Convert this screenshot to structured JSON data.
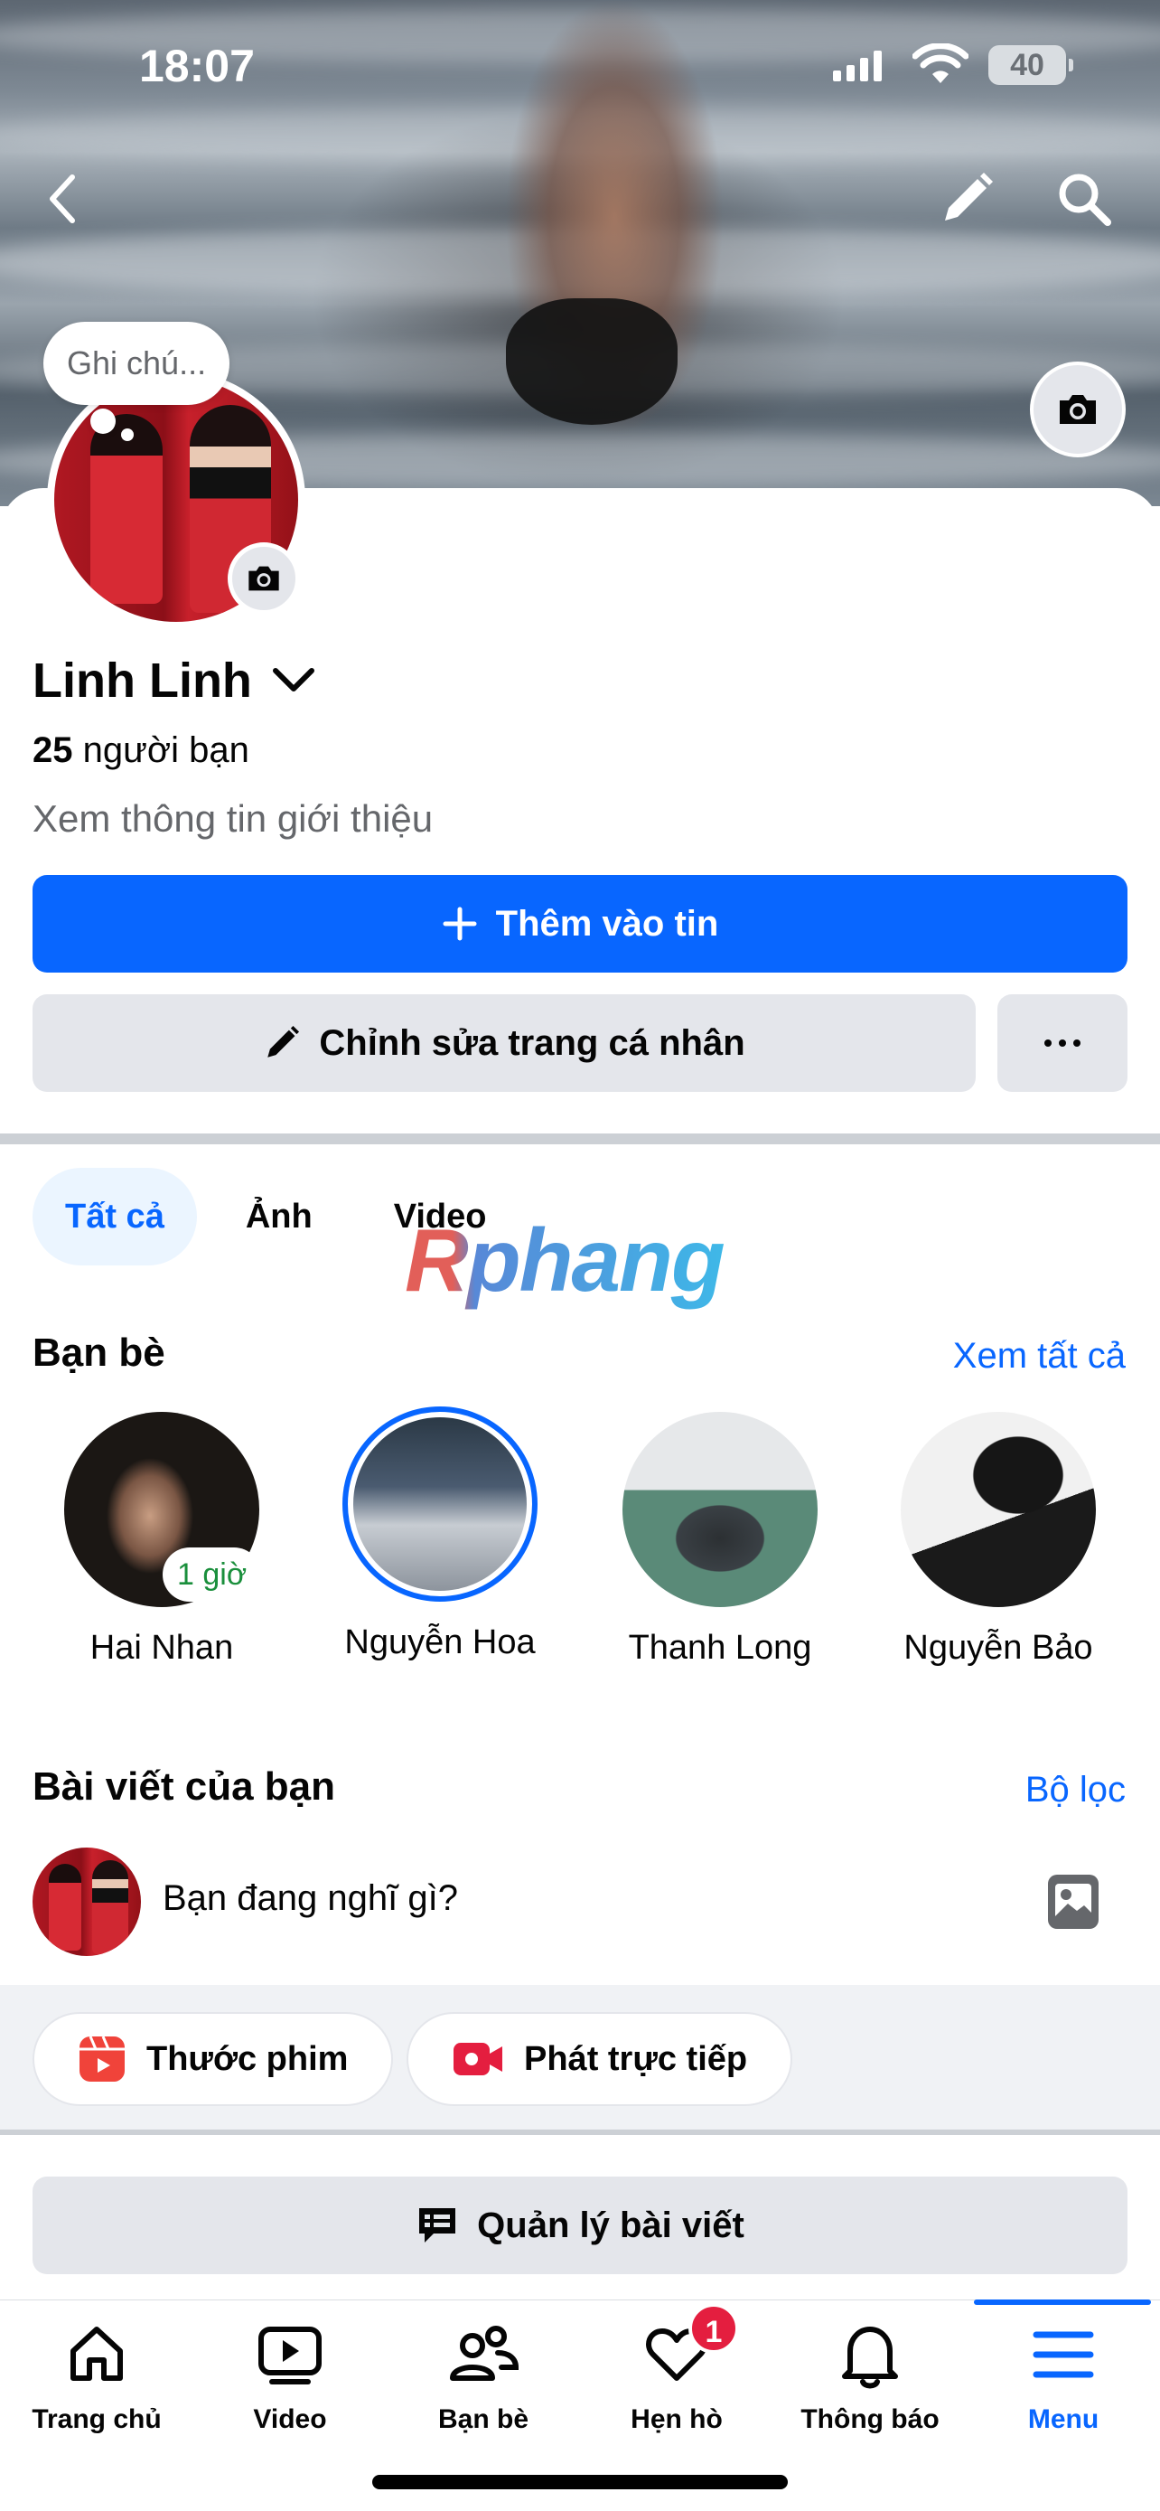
{
  "status_bar": {
    "time": "18:07",
    "battery": "40"
  },
  "profile": {
    "note_placeholder": "Ghi chú...",
    "name": "Linh Linh",
    "friends_count": "25",
    "friends_label": " người bạn",
    "intro_link": "Xem thông tin giới thiệu"
  },
  "actions": {
    "add_story": "Thêm vào tin",
    "edit_profile": "Chỉnh sửa trang cá nhân"
  },
  "tabs": [
    {
      "label": "Tất cả",
      "active": true
    },
    {
      "label": "Ảnh",
      "active": false
    },
    {
      "label": "Video",
      "active": false
    }
  ],
  "watermark": "Rphang",
  "friends_section": {
    "title": "Bạn bè",
    "see_all": "Xem tất cả",
    "items": [
      {
        "name": "Hai Nhan",
        "badge": "1 giờ"
      },
      {
        "name": "Nguyễn Hoa"
      },
      {
        "name": "Thanh Long"
      },
      {
        "name": "Nguyễn Bảo"
      }
    ]
  },
  "posts_section": {
    "title": "Bài viết của bạn",
    "filter": "Bộ lọc",
    "prompt": "Bạn đang nghĩ gì?"
  },
  "chips": [
    {
      "label": "Thước phim",
      "icon": "reels-icon"
    },
    {
      "label": "Phát trực tiếp",
      "icon": "live-video-icon"
    }
  ],
  "manage_posts": "Quản lý bài viết",
  "bottom_nav": [
    {
      "label": "Trang chủ",
      "icon": "home-icon"
    },
    {
      "label": "Video",
      "icon": "video-icon"
    },
    {
      "label": "Bạn bè",
      "icon": "friends-icon"
    },
    {
      "label": "Hẹn hò",
      "icon": "dating-heart-icon",
      "badge": "1"
    },
    {
      "label": "Thông báo",
      "icon": "bell-icon"
    },
    {
      "label": "Menu",
      "icon": "menu-icon",
      "active": true
    }
  ],
  "colors": {
    "accent": "#0866ff",
    "badge_red": "#e41e3f",
    "chip_bg": "#e4e6eb"
  }
}
